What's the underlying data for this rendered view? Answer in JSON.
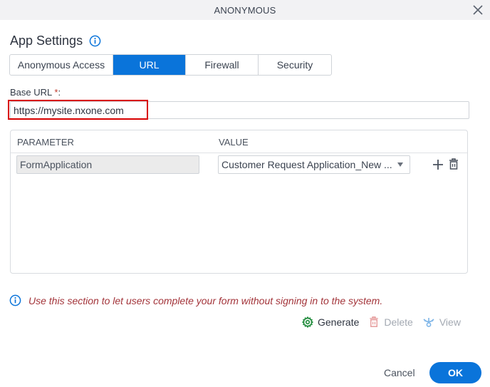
{
  "dialog": {
    "title": "ANONYMOUS",
    "close_icon": "close-icon"
  },
  "section": {
    "heading": "App Settings",
    "info_icon": "info-circle-icon"
  },
  "tabs": [
    {
      "label": "Anonymous Access",
      "active": false
    },
    {
      "label": "URL",
      "active": true
    },
    {
      "label": "Firewall",
      "active": false
    },
    {
      "label": "Security",
      "active": false
    }
  ],
  "base_url": {
    "label": "Base URL",
    "required_mark": "*",
    "colon": ":",
    "value": "https://mysite.nxone.com"
  },
  "params_table": {
    "columns": [
      "PARAMETER",
      "VALUE"
    ],
    "rows": [
      {
        "parameter": "FormApplication",
        "value": "Customer Request Application_New ..."
      }
    ],
    "add_icon": "plus-icon",
    "delete_icon": "trash-icon"
  },
  "note": {
    "icon": "info-circle-icon",
    "text": "Use this section to let users complete your form without signing in to the system."
  },
  "actions": [
    {
      "label": "Generate",
      "icon": "gear-icon",
      "enabled": true
    },
    {
      "label": "Delete",
      "icon": "trash-icon",
      "enabled": false
    },
    {
      "label": "View",
      "icon": "eye-icon",
      "enabled": false
    }
  ],
  "footer": {
    "cancel_label": "Cancel",
    "ok_label": "OK"
  },
  "colors": {
    "accent": "#0a74da",
    "note_text": "#a3343a",
    "highlight": "#d80000",
    "generate_icon": "#1e8a3a",
    "disabled_delete_icon": "#e59a9a",
    "disabled_view_icon": "#7fb6e8"
  }
}
